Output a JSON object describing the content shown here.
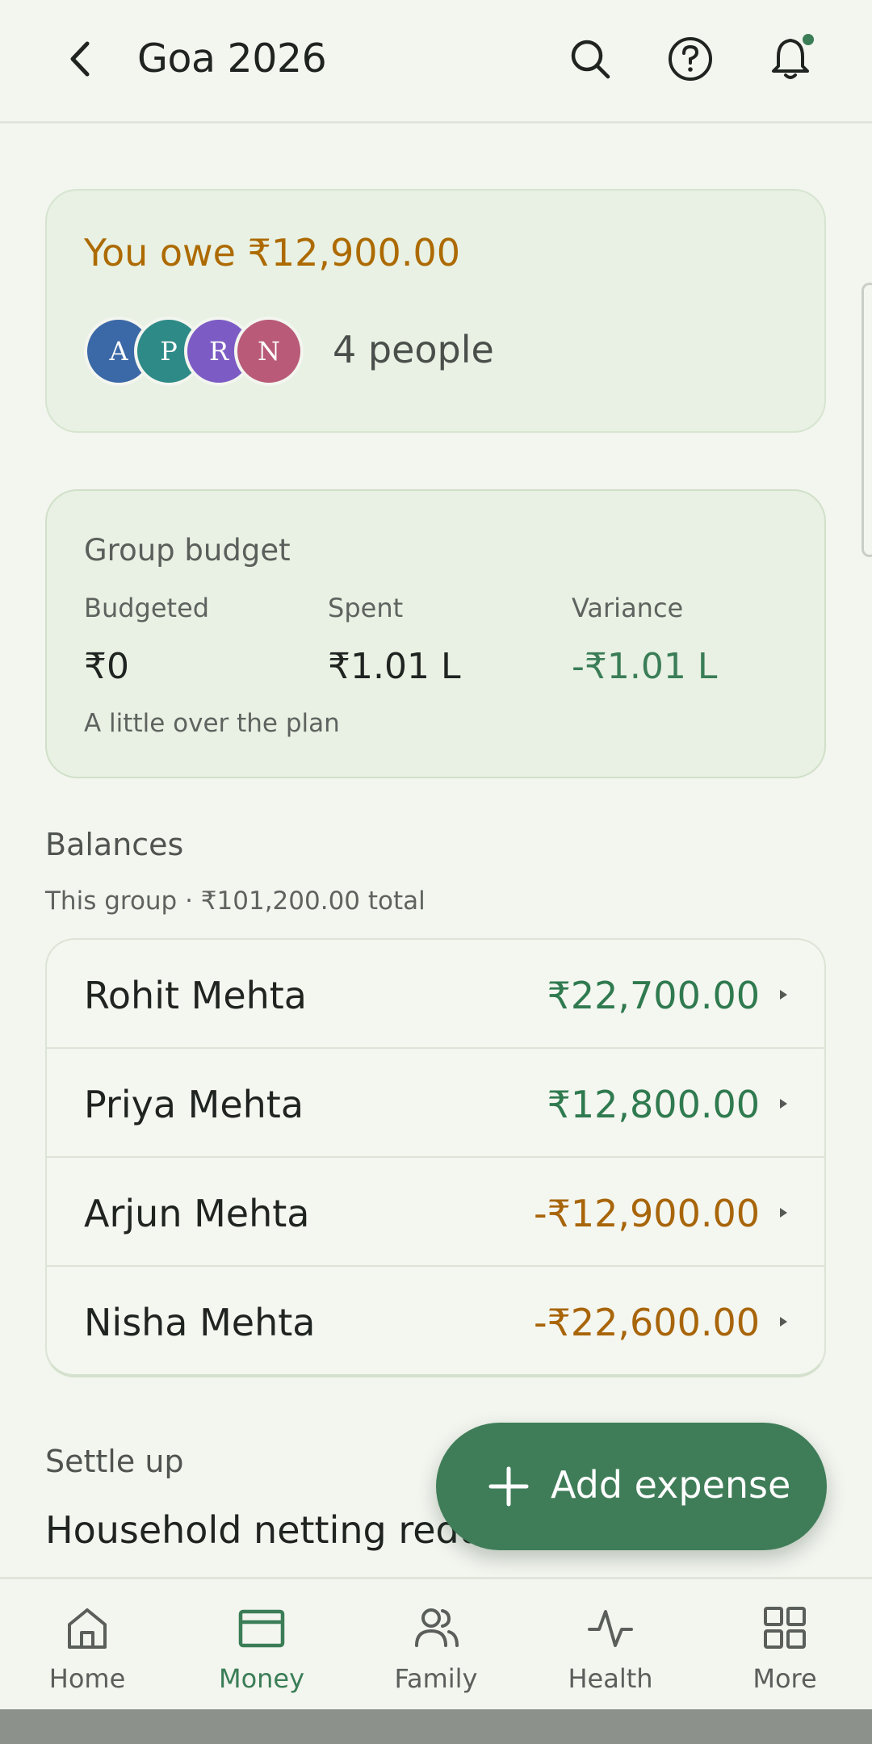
{
  "header": {
    "title": "Goa 2026",
    "icons": [
      "chevron-left-icon",
      "search-icon",
      "help-circle-icon",
      "bell-icon"
    ]
  },
  "owe_card": {
    "text": "You owe ₹12,900.00",
    "people_count": "4 people",
    "avatars": [
      {
        "initial": "A",
        "color": "#3b68a6"
      },
      {
        "initial": "P",
        "color": "#2e8a87"
      },
      {
        "initial": "R",
        "color": "#7c5cc4"
      },
      {
        "initial": "N",
        "color": "#b85a78"
      }
    ]
  },
  "budget": {
    "title": "Group budget",
    "budgeted_label": "Budgeted",
    "budgeted_value": "₹0",
    "spent_label": "Spent",
    "spent_value": "₹1.01 L",
    "variance_label": "Variance",
    "variance_value": "-₹1.01 L",
    "note": "A little over the plan"
  },
  "balances": {
    "title": "Balances",
    "subtitle": "This group · ₹101,200.00 total",
    "rows": [
      {
        "name": "Rohit Mehta",
        "amount": "₹22,700.00"
      },
      {
        "name": "Priya Mehta",
        "amount": "₹12,800.00"
      },
      {
        "name": "Arjun Mehta",
        "amount": "-₹12,900.00"
      },
      {
        "name": "Nisha Mehta",
        "amount": "-₹22,600.00"
      }
    ]
  },
  "settle": {
    "title": "Settle up",
    "text": "Household netting redu"
  },
  "fab": {
    "label": "Add expense"
  },
  "nav": {
    "items": [
      {
        "label": "Home",
        "icon": "home-icon"
      },
      {
        "label": "Money",
        "icon": "wallet-icon"
      },
      {
        "label": "Family",
        "icon": "users-icon"
      },
      {
        "label": "Health",
        "icon": "activity-icon"
      },
      {
        "label": "More",
        "icon": "grid-icon"
      }
    ],
    "active": "Money"
  },
  "colors": {
    "accent": "#3a7d56",
    "owe": "#ad6a00",
    "positive": "#2f7a4f",
    "negative": "#a8650a",
    "card_bg": "#e8f1e3",
    "page_bg": "#f3f5ef"
  }
}
